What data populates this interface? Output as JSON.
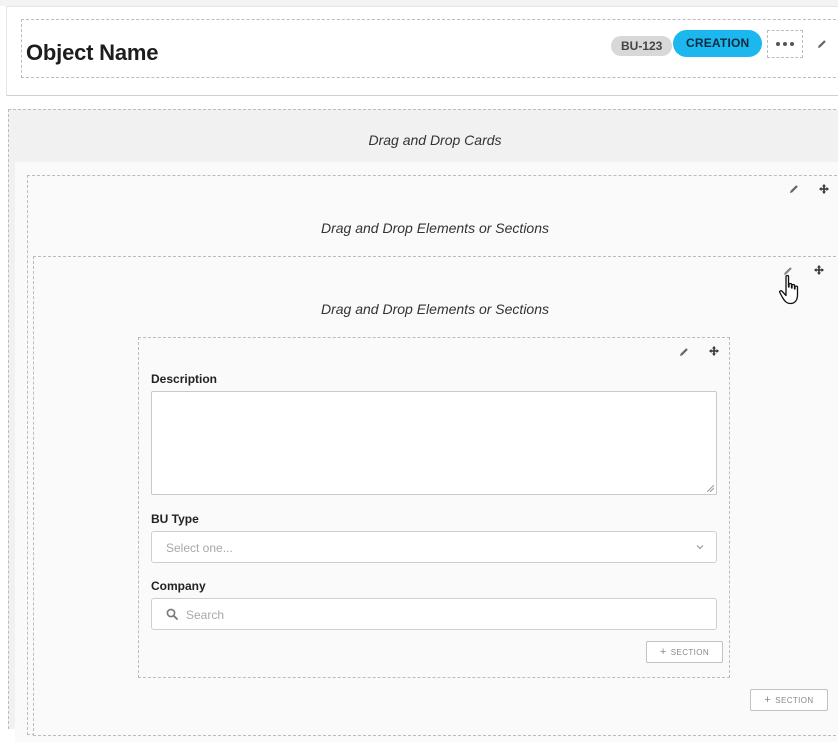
{
  "header": {
    "title": "Object Name",
    "id_badge": "BU-123",
    "status_badge": "CREATION",
    "status_color": "#1bb7ee",
    "more_icon": "ellipsis-icon",
    "edit_icon": "pencil-icon"
  },
  "cards_area": {
    "caption": "Drag and Drop Cards"
  },
  "outer_section": {
    "caption": "Drag and Drop Elements or Sections",
    "edit_icon": "pencil-icon",
    "move_icon": "move-icon",
    "add_section_label": "SECTION"
  },
  "inner_section": {
    "caption": "Drag and Drop Elements or Sections",
    "edit_icon": "pencil-icon",
    "move_icon": "move-icon",
    "cursor_icon": "hand-pointer-icon"
  },
  "element_group": {
    "edit_icon": "pencil-icon",
    "move_icon": "move-icon",
    "fields": {
      "description": {
        "label": "Description",
        "value": ""
      },
      "bu_type": {
        "label": "BU Type",
        "placeholder": "Select one..."
      },
      "company": {
        "label": "Company",
        "placeholder": "Search"
      }
    },
    "add_section_label": "SECTION"
  }
}
